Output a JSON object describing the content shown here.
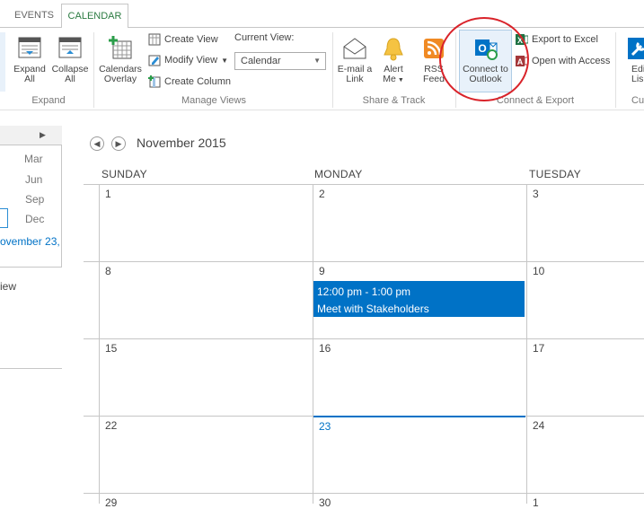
{
  "tabs": [
    {
      "label": "EVENTS",
      "active": false
    },
    {
      "label": "CALENDAR",
      "active": true
    }
  ],
  "ribbon": {
    "expand": {
      "expand_all_line1": "Expand",
      "expand_all_line2": "All",
      "collapse_all_line1": "Collapse",
      "collapse_all_line2": "All",
      "label": "Expand"
    },
    "manage_views": {
      "calendars_overlay_line1": "Calendars",
      "calendars_overlay_line2": "Overlay",
      "create_view": "Create View",
      "modify_view": "Modify View",
      "create_column": "Create Column",
      "current_view_label": "Current View:",
      "current_view_value": "Calendar",
      "label": "Manage Views"
    },
    "share_track": {
      "email_link_line1": "E-mail a",
      "email_link_line2": "Link",
      "alert_me_line1": "Alert",
      "alert_me_line2": "Me",
      "rss_feed_line1": "RSS",
      "rss_feed_line2": "Feed",
      "label": "Share & Track"
    },
    "connect_export": {
      "connect_outlook_line1": "Connect to",
      "connect_outlook_line2": "Outlook",
      "export_excel": "Export to Excel",
      "open_access": "Open with Access",
      "label": "Connect & Export"
    },
    "customize": {
      "edit_list_line1": "Edi",
      "edit_list_line2": "Lis",
      "label": "Cu"
    }
  },
  "leftnav": {
    "months": [
      "Mar",
      "Jun",
      "Sep",
      "Dec"
    ],
    "today_fragment": "ovember 23,",
    "view_fragment": "iew"
  },
  "calendar": {
    "title": "November 2015",
    "day_headers": [
      "SUNDAY",
      "MONDAY",
      "TUESDAY"
    ],
    "weeks": [
      [
        "1",
        "2",
        "3"
      ],
      [
        "8",
        "9",
        "10"
      ],
      [
        "15",
        "16",
        "17"
      ],
      [
        "22",
        "23",
        "24"
      ],
      [
        "29",
        "30",
        "1"
      ]
    ],
    "event": {
      "time": "12:00 pm - 1:00 pm",
      "title": "Meet with Stakeholders"
    }
  },
  "colors": {
    "accent": "#0072c6",
    "tab_active": "#2b7b41",
    "highlight_circle": "#d9232a"
  },
  "icons": [
    "expand-all-icon",
    "collapse-all-icon",
    "calendars-overlay-icon",
    "create-view-icon",
    "modify-view-icon",
    "create-column-icon",
    "email-icon",
    "bell-icon",
    "rss-icon",
    "outlook-icon",
    "excel-icon",
    "access-icon",
    "edit-list-icon",
    "back-arrow-icon",
    "forward-arrow-icon"
  ]
}
